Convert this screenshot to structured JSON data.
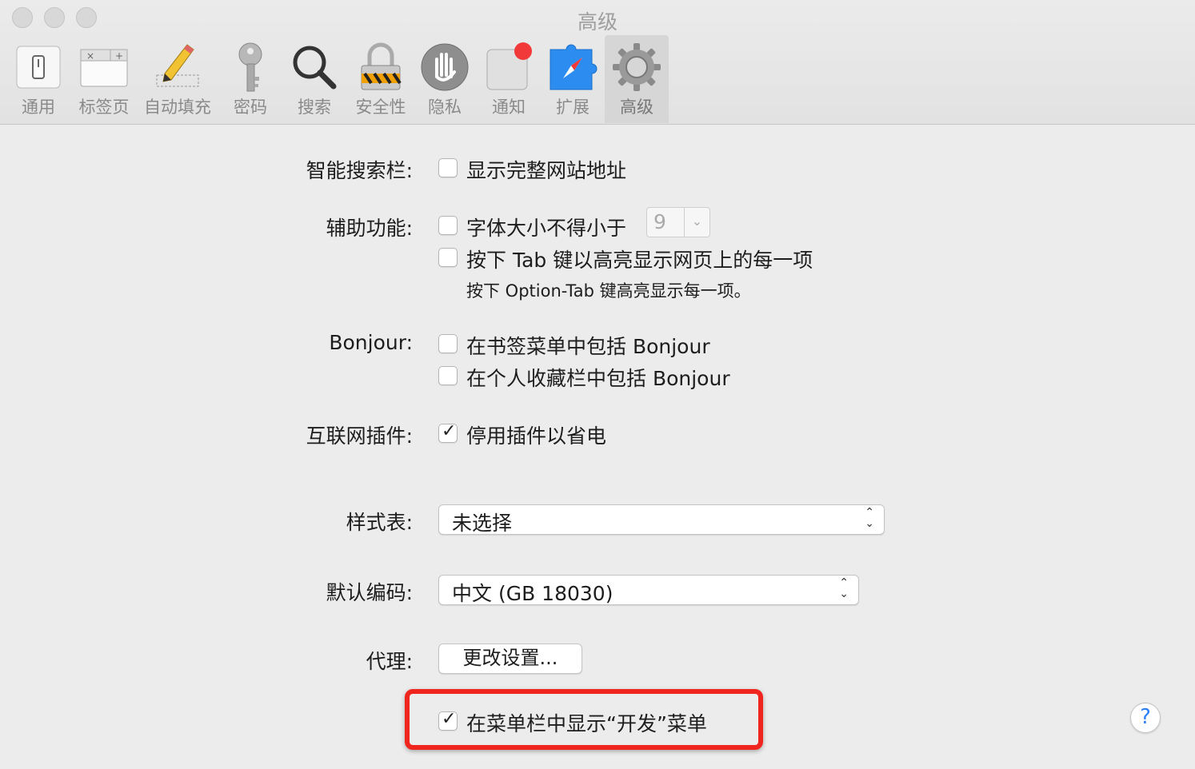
{
  "window": {
    "title": "高级"
  },
  "toolbar": {
    "tabs": [
      {
        "label": "通用",
        "icon": "general-switch-icon"
      },
      {
        "label": "标签页",
        "icon": "tabs-icon"
      },
      {
        "label": "自动填充",
        "icon": "pencil-icon"
      },
      {
        "label": "密码",
        "icon": "key-icon"
      },
      {
        "label": "搜索",
        "icon": "magnifier-icon"
      },
      {
        "label": "安全性",
        "icon": "lock-icon"
      },
      {
        "label": "隐私",
        "icon": "hand-icon"
      },
      {
        "label": "通知",
        "icon": "notification-icon"
      },
      {
        "label": "扩展",
        "icon": "extension-icon"
      },
      {
        "label": "高级",
        "icon": "gear-icon"
      }
    ]
  },
  "smart_search": {
    "label": "智能搜索栏:",
    "show_full_address": "显示完整网站地址"
  },
  "accessibility": {
    "label": "辅助功能:",
    "min_font": "字体大小不得小于",
    "min_font_value": "9",
    "tab_highlight": "按下 Tab 键以高亮显示网页上的每一项",
    "tab_hint": "按下 Option-Tab 键高亮显示每一项。"
  },
  "bonjour": {
    "label": "Bonjour:",
    "bookmarks_menu": "在书签菜单中包括 Bonjour",
    "favorites_bar": "在个人收藏栏中包括 Bonjour"
  },
  "plugins": {
    "label": "互联网插件:",
    "stop_plugins": "停用插件以省电"
  },
  "stylesheet": {
    "label": "样式表:",
    "value": "未选择"
  },
  "encoding": {
    "label": "默认编码:",
    "value": "中文 (GB 18030)"
  },
  "proxy": {
    "label": "代理:",
    "button": "更改设置..."
  },
  "develop": {
    "label": "在菜单栏中显示“开发”菜单"
  },
  "help": {
    "label": "?"
  },
  "colors": {
    "highlight": "#f0261e",
    "accent": "#2d7ff9"
  }
}
